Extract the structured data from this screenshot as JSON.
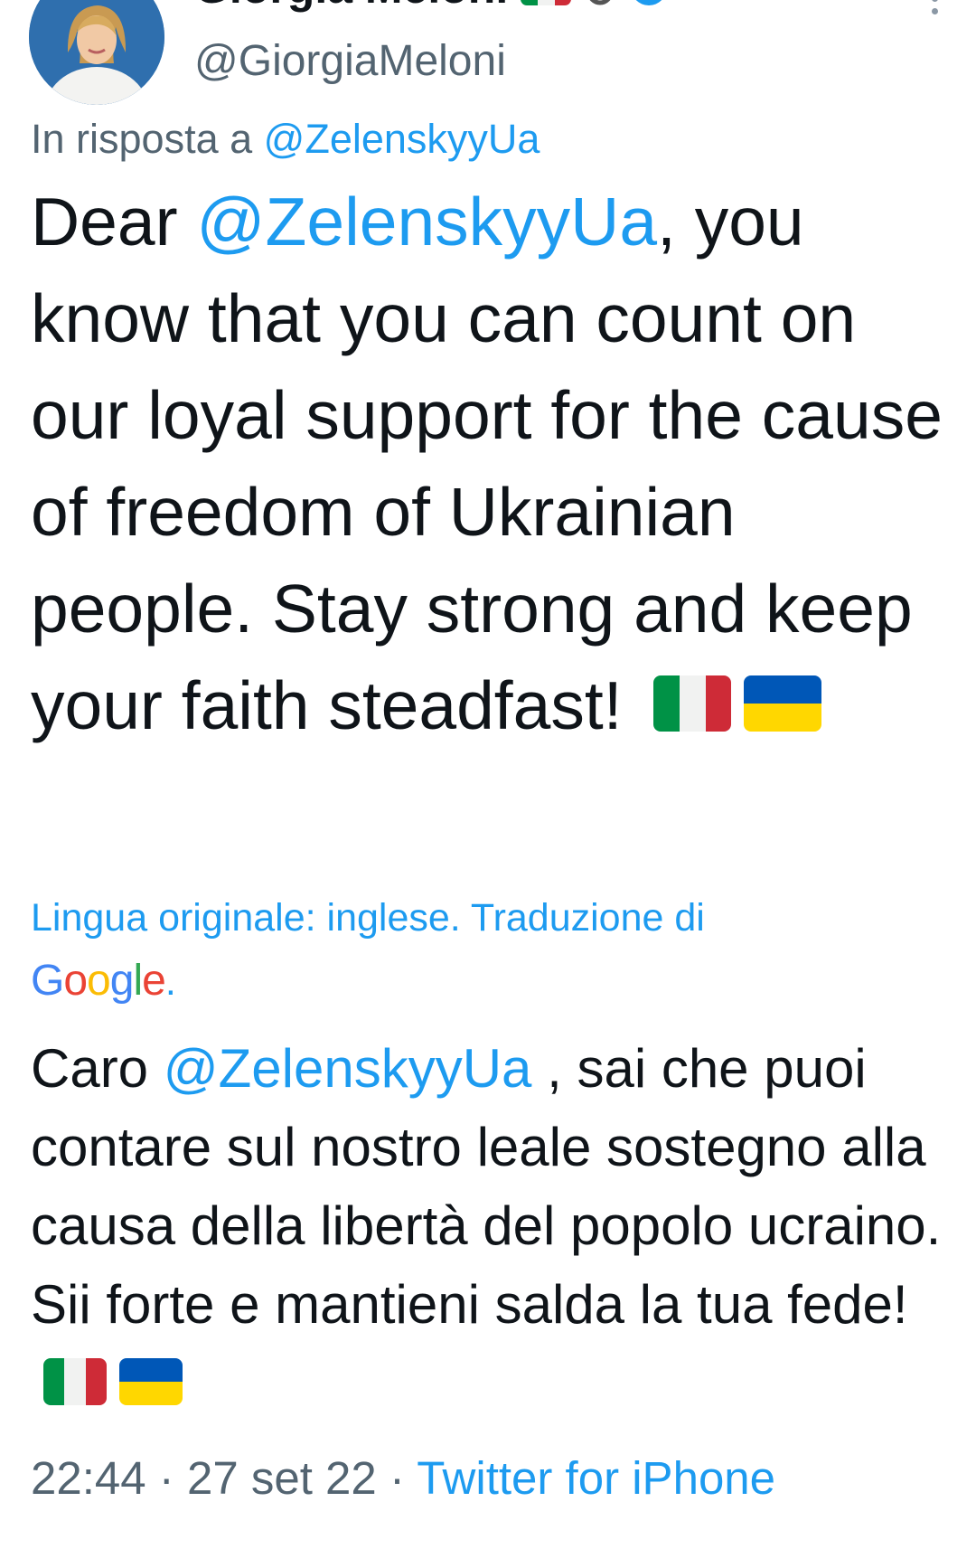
{
  "author": {
    "display_name": "Giorgia Meloni",
    "handle": "@GiorgiaMeloni",
    "name_flag": "italy-flag"
  },
  "reply": {
    "prefix": "In risposta a",
    "mention": "@ZelenskyyUa"
  },
  "tweet": {
    "text_before_mention": "Dear",
    "mention": "@ZelenskyyUa",
    "text_after_mention": ", you know that you can count on our loyal support for the cause of freedom of Ukrainian people. Stay strong and keep your faith steadfast!",
    "flags": [
      "italy-flag",
      "ukraine-flag"
    ]
  },
  "translation": {
    "label": "Lingua originale: inglese. Traduzione di",
    "provider": "Google",
    "provider_suffix": ".",
    "text_before_mention": "Caro",
    "mention": "@ZelenskyyUa",
    "text_after_mention": " , sai che puoi contare sul nostro leale sostegno alla causa della libertà del popolo ucraino. Sii forte e mantieni salda la tua fede!"
  },
  "meta": {
    "time": "22:44",
    "separator": "·",
    "date": "27 set 22",
    "source": "Twitter for iPhone"
  },
  "colors": {
    "accent": "#1d9bf0",
    "secondary_text": "#536471",
    "primary_text": "#0f1419",
    "italy_green": "#009246",
    "italy_white": "#f1f2f1",
    "italy_red": "#ce2b37",
    "ukraine_blue": "#0057b7",
    "ukraine_yellow": "#ffd700"
  }
}
